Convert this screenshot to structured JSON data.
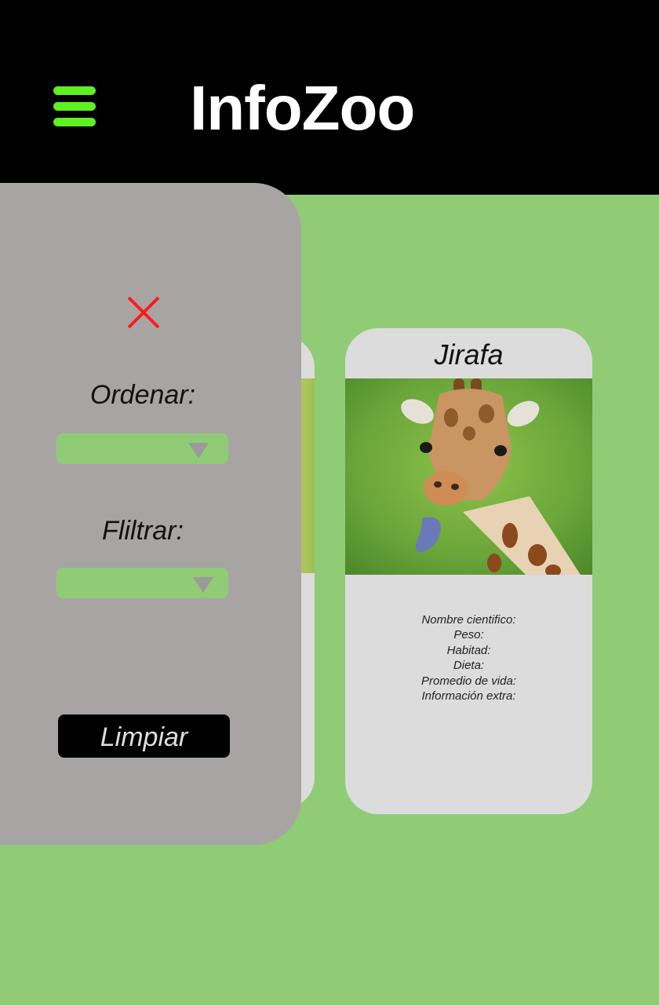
{
  "header": {
    "title": "InfoZoo",
    "menu_icon": "hamburger-menu-icon",
    "accent_color": "#5ef020",
    "background_color": "#000000"
  },
  "page": {
    "background_color": "#90cb76"
  },
  "panel": {
    "close_icon": "close-x-icon",
    "close_color": "#ff1a1a",
    "sort_label": "Ordenar:",
    "filter_label": "Fliltrar:",
    "sort_value": "",
    "filter_value": "",
    "clear_button_label": "Limpiar",
    "background_color": "#a8a4a4"
  },
  "card": {
    "title": "Jirafa",
    "image": "giraffe-photo",
    "fields": [
      "Nombre cientifico:",
      "Peso:",
      "Habitad:",
      "Dieta:",
      "Promedio de vida:",
      "Información extra:"
    ]
  }
}
